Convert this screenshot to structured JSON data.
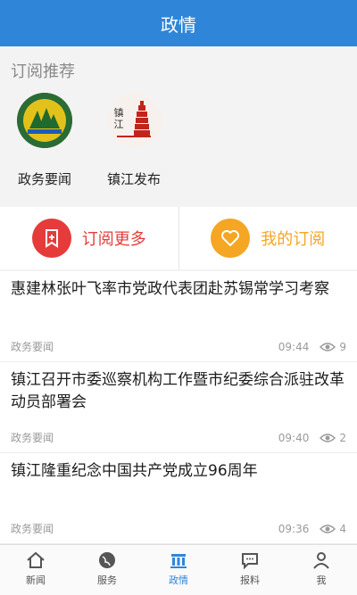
{
  "header": {
    "title": "政情"
  },
  "subscriptions": {
    "section_title": "订阅推荐",
    "items": [
      {
        "label": "政务要闻"
      },
      {
        "label": "镇江发布",
        "logo_text": "镇江"
      }
    ]
  },
  "actions": {
    "subscribe_more": "订阅更多",
    "my_subscriptions": "我的订阅",
    "colors": {
      "subscribe_more": "#e63b3b",
      "my_subscriptions": "#f5a623"
    }
  },
  "news": [
    {
      "title": "惠建林张叶飞率市党政代表团赴苏锡常学习考察",
      "source": "政务要闻",
      "time": "09:44",
      "views": "9"
    },
    {
      "title": "镇江召开市委巡察机构工作暨市纪委综合派驻改革动员部署会",
      "source": "政务要闻",
      "time": "09:40",
      "views": "2"
    },
    {
      "title": "镇江隆重纪念中国共产党成立96周年",
      "source": "政务要闻",
      "time": "09:36",
      "views": "4"
    }
  ],
  "tabbar": {
    "items": [
      {
        "label": "新闻",
        "icon": "home-icon"
      },
      {
        "label": "服务",
        "icon": "globe-icon"
      },
      {
        "label": "政情",
        "icon": "building-icon",
        "active": true
      },
      {
        "label": "报料",
        "icon": "chat-icon"
      },
      {
        "label": "我",
        "icon": "person-icon"
      }
    ],
    "accent": "#2f86d8"
  }
}
